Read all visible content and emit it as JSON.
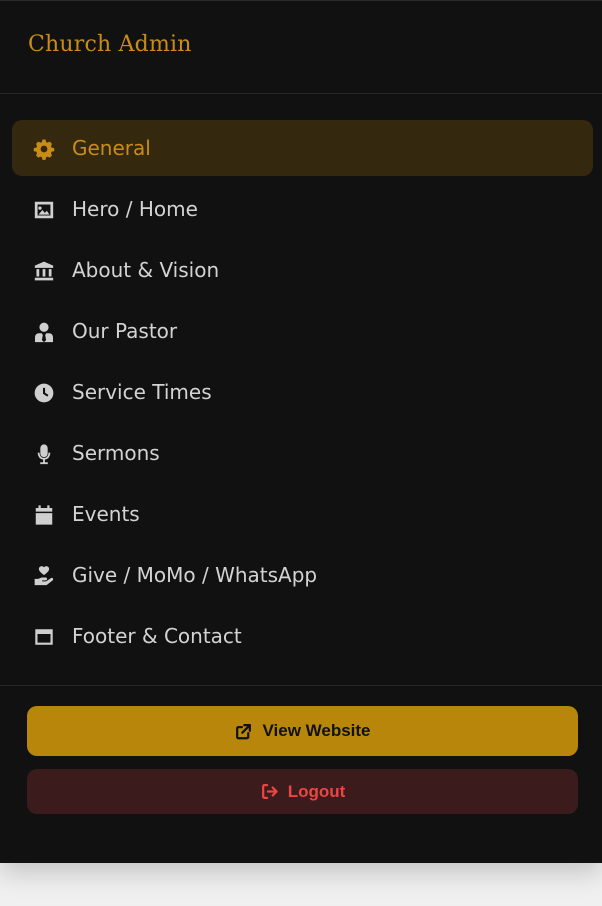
{
  "brand": {
    "title": "Church Admin"
  },
  "nav": {
    "items": [
      {
        "label": "General",
        "icon": "gear-icon",
        "active": true
      },
      {
        "label": "Hero / Home",
        "icon": "image-icon",
        "active": false
      },
      {
        "label": "About & Vision",
        "icon": "building-icon",
        "active": false
      },
      {
        "label": "Our Pastor",
        "icon": "user-tie-icon",
        "active": false
      },
      {
        "label": "Service Times",
        "icon": "clock-icon",
        "active": false
      },
      {
        "label": "Sermons",
        "icon": "microphone-icon",
        "active": false
      },
      {
        "label": "Events",
        "icon": "calendar-icon",
        "active": false
      },
      {
        "label": "Give / MoMo / WhatsApp",
        "icon": "hand-heart-icon",
        "active": false
      },
      {
        "label": "Footer & Contact",
        "icon": "window-icon",
        "active": false
      }
    ]
  },
  "actions": {
    "view_website": {
      "label": "View Website",
      "icon": "external-link-icon"
    },
    "logout": {
      "label": "Logout",
      "icon": "logout-icon"
    }
  },
  "colors": {
    "background": "#111111",
    "accent": "#c98d17",
    "active_bg": "#34280f",
    "view_button": "#b8860b",
    "logout_bg": "#3b1b1c",
    "logout_text": "#ef4444"
  }
}
